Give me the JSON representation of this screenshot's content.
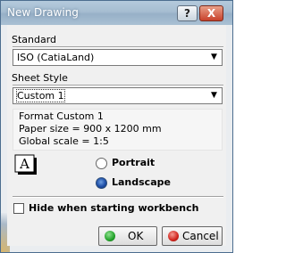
{
  "window": {
    "title": "New Drawing",
    "help_glyph": "?",
    "close_glyph": "X"
  },
  "standard": {
    "label": "Standard",
    "value": "ISO (CatiaLand)"
  },
  "sheet_style": {
    "label": "Sheet Style",
    "value": "Custom 1"
  },
  "format_info": {
    "line1": "Format Custom 1",
    "line2": "Paper size = 900 x 1200 mm",
    "line3": "Global scale = 1:5"
  },
  "orientation": {
    "icon_letter": "A",
    "portrait_label": "Portrait",
    "landscape_label": "Landscape",
    "selected": "Landscape"
  },
  "hide_option": {
    "label": "Hide when starting workbench",
    "checked": false
  },
  "buttons": {
    "ok_label": "OK",
    "cancel_label": "Cancel"
  },
  "colors": {
    "ok_icon": "#22a22a",
    "cancel_icon": "#d0231c",
    "radio_selected": "#1f4fa8"
  }
}
